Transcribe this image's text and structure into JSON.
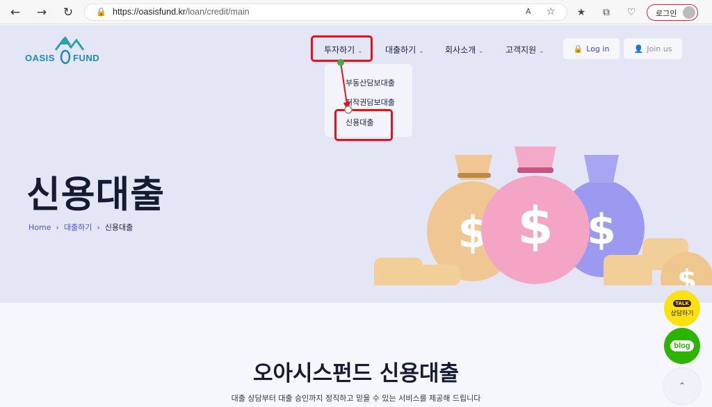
{
  "browser": {
    "url_host": "https://oasisfund.kr",
    "url_path": "/loan/credit/main",
    "login_label": "로그인"
  },
  "site": {
    "logo_left": "OASIS",
    "logo_right": "FUND",
    "menu": [
      {
        "label": "투자하기"
      },
      {
        "label": "대출하기"
      },
      {
        "label": "회사소개"
      },
      {
        "label": "고객지원"
      }
    ],
    "login_btn": "Log in",
    "join_btn": "Join us",
    "dropdown": [
      "부동산담보대출",
      "저작권담보대출",
      "신용대출"
    ]
  },
  "hero": {
    "title": "신용대출",
    "breadcrumb": [
      "Home",
      "대출하기",
      "신용대출"
    ]
  },
  "section": {
    "title": "오아시스펀드 신용대출",
    "subtitle": "대출 상담부터 대출 승인까지 정직하고 믿을 수 있는 서비스를 제공해 드립니다"
  },
  "floating": {
    "talk_badge": "TALK",
    "talk_label": "상담하기",
    "blog_label": "blog",
    "top_icon": "chevron-up-icon"
  },
  "colors": {
    "accent": "#4a55c6",
    "highlight": "#e0121a",
    "hero_bg": "#e4e6f6"
  }
}
